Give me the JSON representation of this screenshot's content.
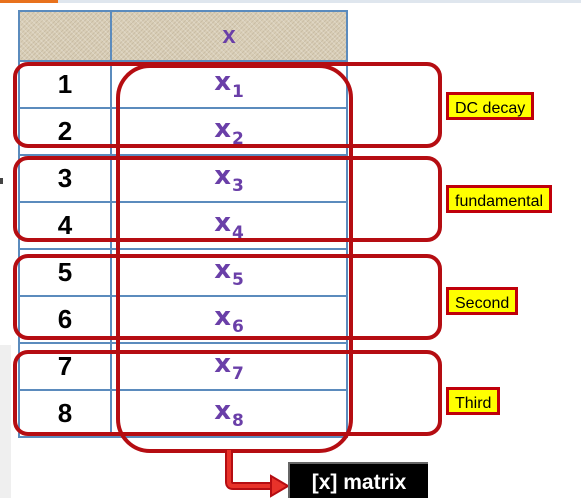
{
  "table": {
    "header": "x",
    "rows": [
      {
        "index": "1",
        "var": "x",
        "sub": "1"
      },
      {
        "index": "2",
        "var": "x",
        "sub": "2"
      },
      {
        "index": "3",
        "var": "x",
        "sub": "3"
      },
      {
        "index": "4",
        "var": "x",
        "sub": "4"
      },
      {
        "index": "5",
        "var": "x",
        "sub": "5"
      },
      {
        "index": "6",
        "var": "x",
        "sub": "6"
      },
      {
        "index": "7",
        "var": "x",
        "sub": "7"
      },
      {
        "index": "8",
        "var": "x",
        "sub": "8"
      }
    ]
  },
  "groups": [
    {
      "label": "DC decay"
    },
    {
      "label": "fundamental"
    },
    {
      "label": "Second"
    },
    {
      "label": "Third"
    }
  ],
  "output_label": "[x] matrix",
  "colors": {
    "group_border": "#b50d12",
    "tag_fill": "#ffff00",
    "variable_text": "#6a3fa8",
    "table_border": "#5b8bbd"
  }
}
